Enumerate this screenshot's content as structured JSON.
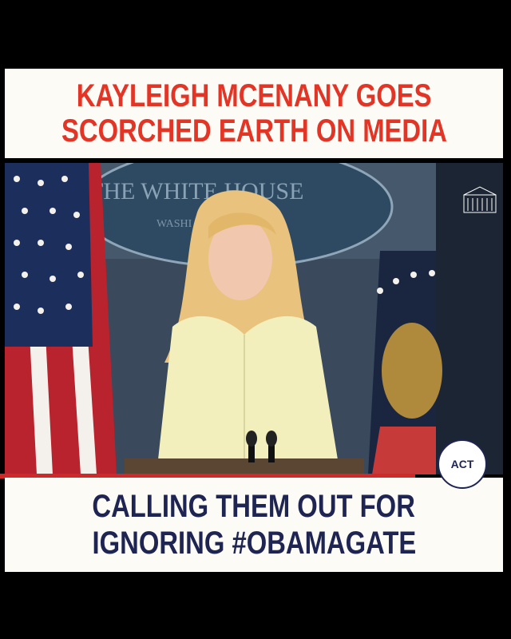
{
  "header": {
    "line1": "KAYLEIGH MCENANY GOES",
    "line2": "SCORCHED EARTH ON MEDIA"
  },
  "scene": {
    "backdrop_text": "THE WHITE HOUSE",
    "backdrop_subtext": "WASHI",
    "icons": [
      "american-flag-icon",
      "presidential-flag-icon",
      "white-house-logo-icon",
      "microphone-icon"
    ]
  },
  "caption": {
    "line1": "CALLING THEM OUT FOR",
    "line2": "IGNORING #OBAMAGATE"
  },
  "badge": {
    "label": "ACT"
  },
  "colors": {
    "headline": "#e23526",
    "caption": "#1e2552",
    "banner_bg": "#fdfbf6",
    "accent_bar": "#cf2a2a"
  }
}
